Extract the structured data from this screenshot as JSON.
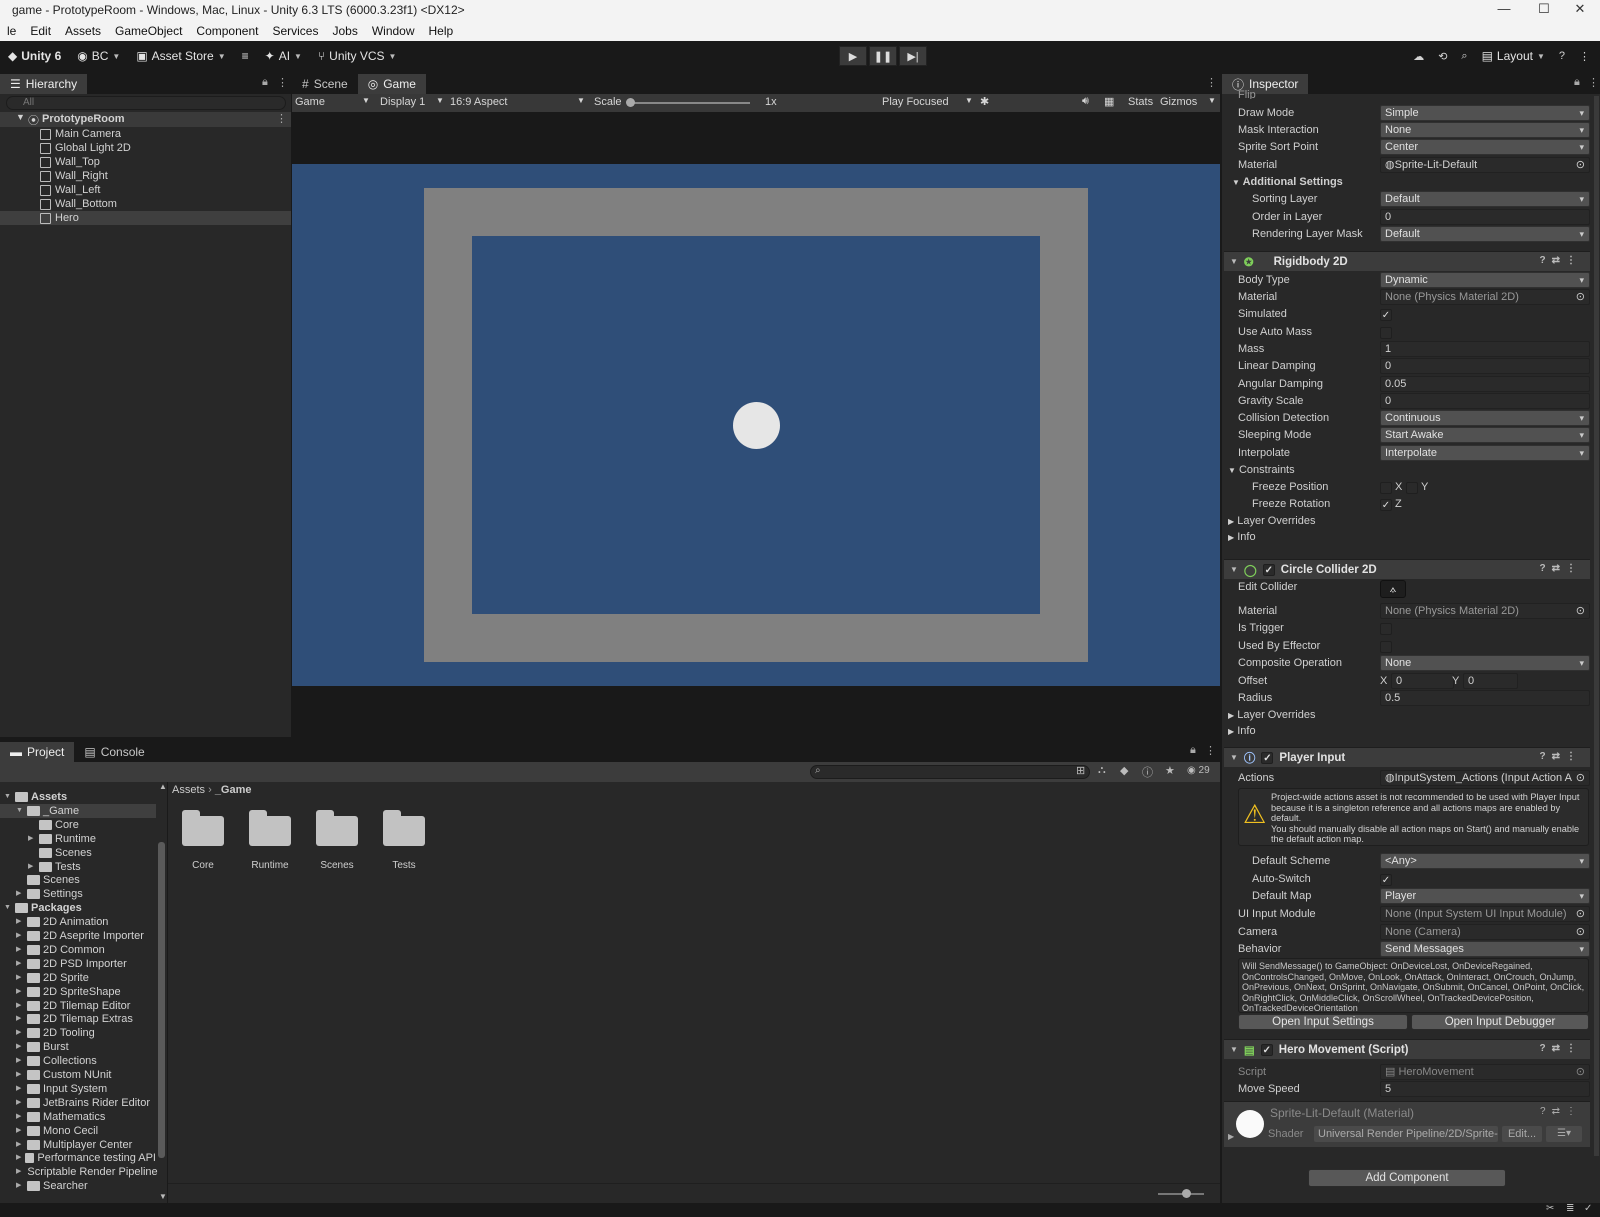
{
  "window": {
    "title": "game - PrototypeRoom - Windows, Mac, Linux - Unity 6.3 LTS (6000.3.23f1) <DX12>"
  },
  "menu": [
    "le",
    "Edit",
    "Assets",
    "GameObject",
    "Component",
    "Services",
    "Jobs",
    "Window",
    "Help"
  ],
  "toolbar": {
    "unity": "Unity 6",
    "account": "BC",
    "asset_store": "Asset Store",
    "ai": "AI",
    "vcs": "Unity VCS",
    "layout": "Layout"
  },
  "hierarchy": {
    "tab": "Hierarchy",
    "search_placeholder": "All",
    "scene": "PrototypeRoom",
    "items": [
      "Main Camera",
      "Global Light 2D",
      "Wall_Top",
      "Wall_Right",
      "Wall_Left",
      "Wall_Bottom",
      "Hero"
    ]
  },
  "scene_tabs": {
    "scene": "Scene",
    "game": "Game"
  },
  "game_bar": {
    "view": "Game",
    "display": "Display 1",
    "aspect": "16:9 Aspect",
    "scale_label": "Scale",
    "scale_value": "1x",
    "play_mode": "Play Focused",
    "stats": "Stats",
    "gizmos": "Gizmos"
  },
  "game_view": {
    "bg": "#2f4e78",
    "wall": "#808080",
    "floor": "#2f4e78",
    "hero": "#e6e6e6"
  },
  "project": {
    "tab": "Project",
    "console_tab": "Console",
    "count": "29",
    "breadcrumb": [
      "Assets",
      "_Game"
    ],
    "tree": [
      {
        "label": "Assets",
        "bold": true,
        "lvl": 0
      },
      {
        "label": "_Game",
        "lvl": 1,
        "sel": true
      },
      {
        "label": "Core",
        "lvl": 2
      },
      {
        "label": "Runtime",
        "lvl": 2,
        "arrow": true
      },
      {
        "label": "Scenes",
        "lvl": 2
      },
      {
        "label": "Tests",
        "lvl": 2,
        "arrow": true
      },
      {
        "label": "Scenes",
        "lvl": 1
      },
      {
        "label": "Settings",
        "lvl": 1,
        "arrow": true
      },
      {
        "label": "Packages",
        "bold": true,
        "lvl": 0
      },
      {
        "label": "2D Animation",
        "lvl": 1,
        "arrow": true
      },
      {
        "label": "2D Aseprite Importer",
        "lvl": 1,
        "arrow": true
      },
      {
        "label": "2D Common",
        "lvl": 1,
        "arrow": true
      },
      {
        "label": "2D PSD Importer",
        "lvl": 1,
        "arrow": true
      },
      {
        "label": "2D Sprite",
        "lvl": 1,
        "arrow": true
      },
      {
        "label": "2D SpriteShape",
        "lvl": 1,
        "arrow": true
      },
      {
        "label": "2D Tilemap Editor",
        "lvl": 1,
        "arrow": true
      },
      {
        "label": "2D Tilemap Extras",
        "lvl": 1,
        "arrow": true
      },
      {
        "label": "2D Tooling",
        "lvl": 1,
        "arrow": true
      },
      {
        "label": "Burst",
        "lvl": 1,
        "arrow": true
      },
      {
        "label": "Collections",
        "lvl": 1,
        "arrow": true
      },
      {
        "label": "Custom NUnit",
        "lvl": 1,
        "arrow": true
      },
      {
        "label": "Input System",
        "lvl": 1,
        "arrow": true
      },
      {
        "label": "JetBrains Rider Editor",
        "lvl": 1,
        "arrow": true
      },
      {
        "label": "Mathematics",
        "lvl": 1,
        "arrow": true
      },
      {
        "label": "Mono Cecil",
        "lvl": 1,
        "arrow": true
      },
      {
        "label": "Multiplayer Center",
        "lvl": 1,
        "arrow": true
      },
      {
        "label": "Performance testing API",
        "lvl": 1,
        "arrow": true
      },
      {
        "label": "Scriptable Render Pipeline",
        "lvl": 1,
        "arrow": true
      },
      {
        "label": "Searcher",
        "lvl": 1,
        "arrow": true
      }
    ],
    "folders": [
      "Core",
      "Runtime",
      "Scenes",
      "Tests"
    ]
  },
  "inspector": {
    "tab": "Inspector",
    "sprite": {
      "flip": "Flip",
      "draw_mode": "Draw Mode",
      "draw_mode_v": "Simple",
      "mask": "Mask Interaction",
      "mask_v": "None",
      "sort_point": "Sprite Sort Point",
      "sort_point_v": "Center",
      "material": "Material",
      "material_v": "Sprite-Lit-Default",
      "additional": "Additional Settings",
      "sorting_layer": "Sorting Layer",
      "sorting_layer_v": "Default",
      "order": "Order in Layer",
      "order_v": "0",
      "rlm": "Rendering Layer Mask",
      "rlm_v": "Default"
    },
    "rb": {
      "title": "Rigidbody 2D",
      "body_type": "Body Type",
      "body_type_v": "Dynamic",
      "material": "Material",
      "material_v": "None (Physics Material 2D)",
      "simulated": "Simulated",
      "auto_mass": "Use Auto Mass",
      "mass": "Mass",
      "mass_v": "1",
      "lin": "Linear Damping",
      "lin_v": "0",
      "ang": "Angular Damping",
      "ang_v": "0.05",
      "grav": "Gravity Scale",
      "grav_v": "0",
      "coll": "Collision Detection",
      "coll_v": "Continuous",
      "sleep": "Sleeping Mode",
      "sleep_v": "Start Awake",
      "interp": "Interpolate",
      "interp_v": "Interpolate",
      "constraints": "Constraints",
      "freeze_pos": "Freeze Position",
      "freeze_rot": "Freeze Rotation",
      "x": "X",
      "y": "Y",
      "z": "Z",
      "layer_overrides": "Layer Overrides",
      "info": "Info"
    },
    "cc": {
      "title": "Circle Collider 2D",
      "edit": "Edit Collider",
      "material": "Material",
      "material_v": "None (Physics Material 2D)",
      "trigger": "Is Trigger",
      "effector": "Used By Effector",
      "composite": "Composite Operation",
      "composite_v": "None",
      "offset": "Offset",
      "ox": "0",
      "oy": "0",
      "radius": "Radius",
      "radius_v": "0.5",
      "layer_overrides": "Layer Overrides",
      "info": "Info"
    },
    "pi": {
      "title": "Player Input",
      "actions": "Actions",
      "actions_v": "InputSystem_Actions (Input Action A",
      "warning": "Project-wide actions asset is not recommended to be used with Player Input because it is a singleton reference and all actions maps are enabled by default.\nYou should manually disable all action maps on Start() and manually enable the default action map.",
      "scheme": "Default Scheme",
      "scheme_v": "<Any>",
      "auto": "Auto-Switch",
      "map": "Default Map",
      "map_v": "Player",
      "ui": "UI Input Module",
      "ui_v": "None (Input System UI Input Module)",
      "camera": "Camera",
      "camera_v": "None (Camera)",
      "behavior": "Behavior",
      "behavior_v": "Send Messages",
      "messages": "Will SendMessage() to GameObject: OnDeviceLost, OnDeviceRegained, OnControlsChanged, OnMove, OnLook, OnAttack, OnInteract, OnCrouch, OnJump, OnPrevious, OnNext, OnSprint, OnNavigate, OnSubmit, OnCancel, OnPoint, OnClick, OnRightClick, OnMiddleClick, OnScrollWheel, OnTrackedDevicePosition, OnTrackedDeviceOrientation",
      "settings_btn": "Open Input Settings",
      "debugger_btn": "Open Input Debugger"
    },
    "hm": {
      "title": "Hero Movement (Script)",
      "script": "Script",
      "script_v": "HeroMovement",
      "speed": "Move Speed",
      "speed_v": "5"
    },
    "mat": {
      "title": "Sprite-Lit-Default (Material)",
      "shader": "Shader",
      "shader_v": "Universal Render Pipeline/2D/Sprite-",
      "edit": "Edit..."
    },
    "add_component": "Add Component"
  }
}
